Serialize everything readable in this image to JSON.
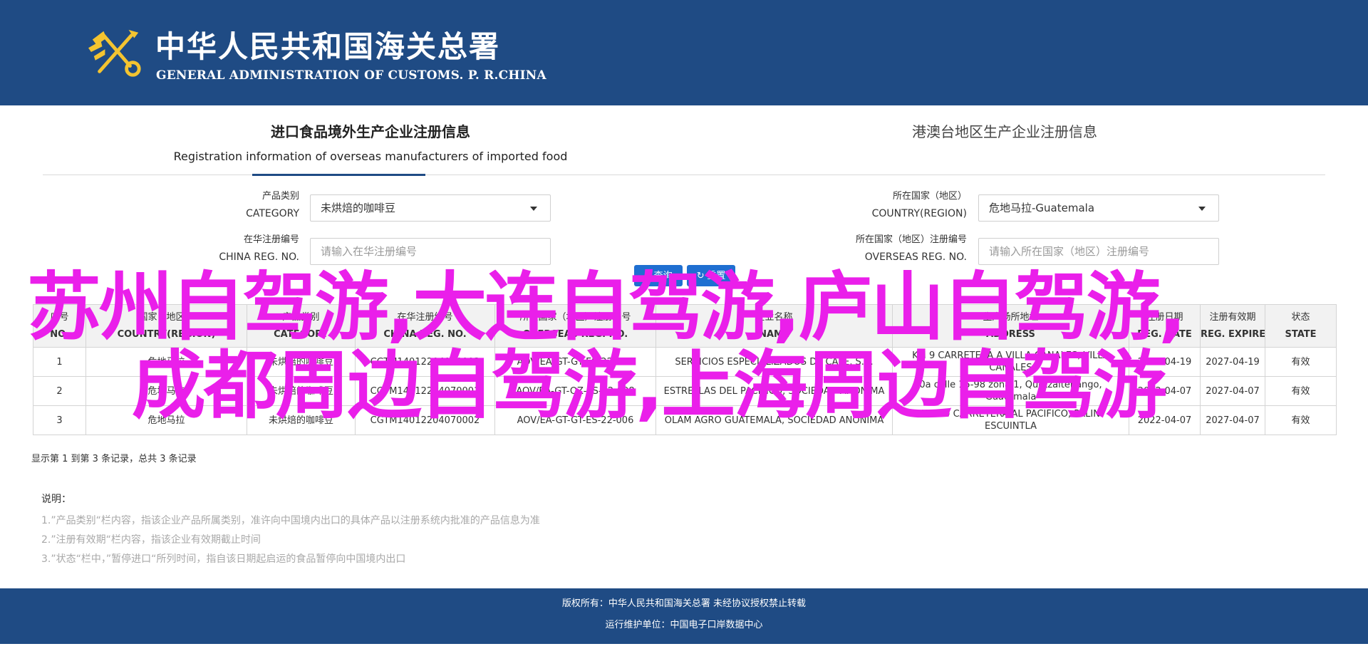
{
  "header": {
    "title_cn": "中华人民共和国海关总署",
    "title_en": "GENERAL ADMINISTRATION OF CUSTOMS. P. R.CHINA",
    "emblem_icon": "customs-emblem-icon",
    "bg_color": "#1f4b84"
  },
  "tabs": [
    {
      "title": "进口食品境外生产企业注册信息",
      "subtitle": "Registration information of overseas manufacturers of imported food",
      "active": true
    },
    {
      "title": "港澳台地区生产企业注册信息",
      "subtitle": "",
      "active": false
    }
  ],
  "form": {
    "category": {
      "label_cn": "产品类别",
      "label_en": "CATEGORY",
      "value": "未烘焙的咖啡豆"
    },
    "country": {
      "label_cn": "所在国家（地区）",
      "label_en": "COUNTRY(REGION)",
      "value": "危地马拉-Guatemala"
    },
    "china_reg": {
      "label_cn": "在华注册编号",
      "label_en": "CHINA REG. NO.",
      "placeholder": "请输入在华注册编号"
    },
    "overseas_reg": {
      "label_cn": "所在国家（地区）注册编号",
      "label_en": "OVERSEAS REG. NO.",
      "placeholder": "请输入所在国家（地区）注册编号"
    },
    "search_label": "查询",
    "reset_label": "重置",
    "accent_color": "#1f6fd1"
  },
  "table": {
    "headers": [
      {
        "cn": "序号",
        "en": "NO."
      },
      {
        "cn": "国家（地区）",
        "en": "COUNTRY(REGION)"
      },
      {
        "cn": "产品类别",
        "en": "CATEGORY"
      },
      {
        "cn": "在华注册编号",
        "en": "CHINA REG. NO."
      },
      {
        "cn": "所在国家（地区）注册编号",
        "en": "OVERSEAS REG. NO."
      },
      {
        "cn": "企业名称",
        "en": "NAME"
      },
      {
        "cn": "生产场所地址",
        "en": "ADDRESS"
      },
      {
        "cn": "注册日期",
        "en": "REG. DATE"
      },
      {
        "cn": "注册有效期",
        "en": "REG. EXPIRE D..."
      },
      {
        "cn": "状态",
        "en": "STATE"
      }
    ],
    "rows": [
      [
        "1",
        "危地马拉",
        "未烘焙的咖啡豆",
        "CGTM14012204070003",
        "AOV/EA-GT-GT-ES-22-010",
        "SERVICIOS ESPECIALIZADOS DE CAFE, S.A.",
        "KM 9 CARRETERA A VILLA CANALES, VILLA CANALES",
        "2022-04-19",
        "2027-04-19",
        "有效"
      ],
      [
        "2",
        "危地马拉",
        "未烘焙的咖啡豆",
        "CGTM14012204070001",
        "AOV/EA-GT-QZ-ES-22-008",
        "ESTRELLAS DEL PACIFICO, SOCIEDAD ANONIMA",
        "0a calle 15-98 zona 1, Quetzaltenango, Guatemala",
        "2022-04-07",
        "2027-04-07",
        "有效"
      ],
      [
        "3",
        "危地马拉",
        "未烘焙的咖啡豆",
        "CGTM14012204070002",
        "AOV/EA-GT-GT-ES-22-006",
        "OLAM AGRO GUATEMALA, SOCIEDAD ANONIMA",
        "KM 30 CARRETERA AL PACIFICO, PALIN ESCUINTLA",
        "2022-04-07",
        "2027-04-07",
        "有效"
      ]
    ],
    "records_text": "显示第 1 到第 3 条记录，总共 3 条记录"
  },
  "notes": {
    "title": "说明：",
    "items": [
      "1.”产品类别“栏内容，指该企业产品所属类别，准许向中国境内出口的具体产品以注册系统内批准的产品信息为准",
      "2.”注册有效期“栏内容，指该企业有效期截止时间",
      "3.”状态“栏中，”暂停进口“所列时间，指自该日期起启运的食品暂停向中国境内出口"
    ]
  },
  "footer": {
    "line1": "版权所有：中华人民共和国海关总署 未经协议授权禁止转载",
    "line2": "运行维护单位：中国电子口岸数据中心"
  },
  "overlay": {
    "line1": "苏州自驾游,大连自驾游,庐山自驾游,",
    "line2": "成都周边自驾游,上海周边自驾游",
    "color": "#ea1fea"
  }
}
